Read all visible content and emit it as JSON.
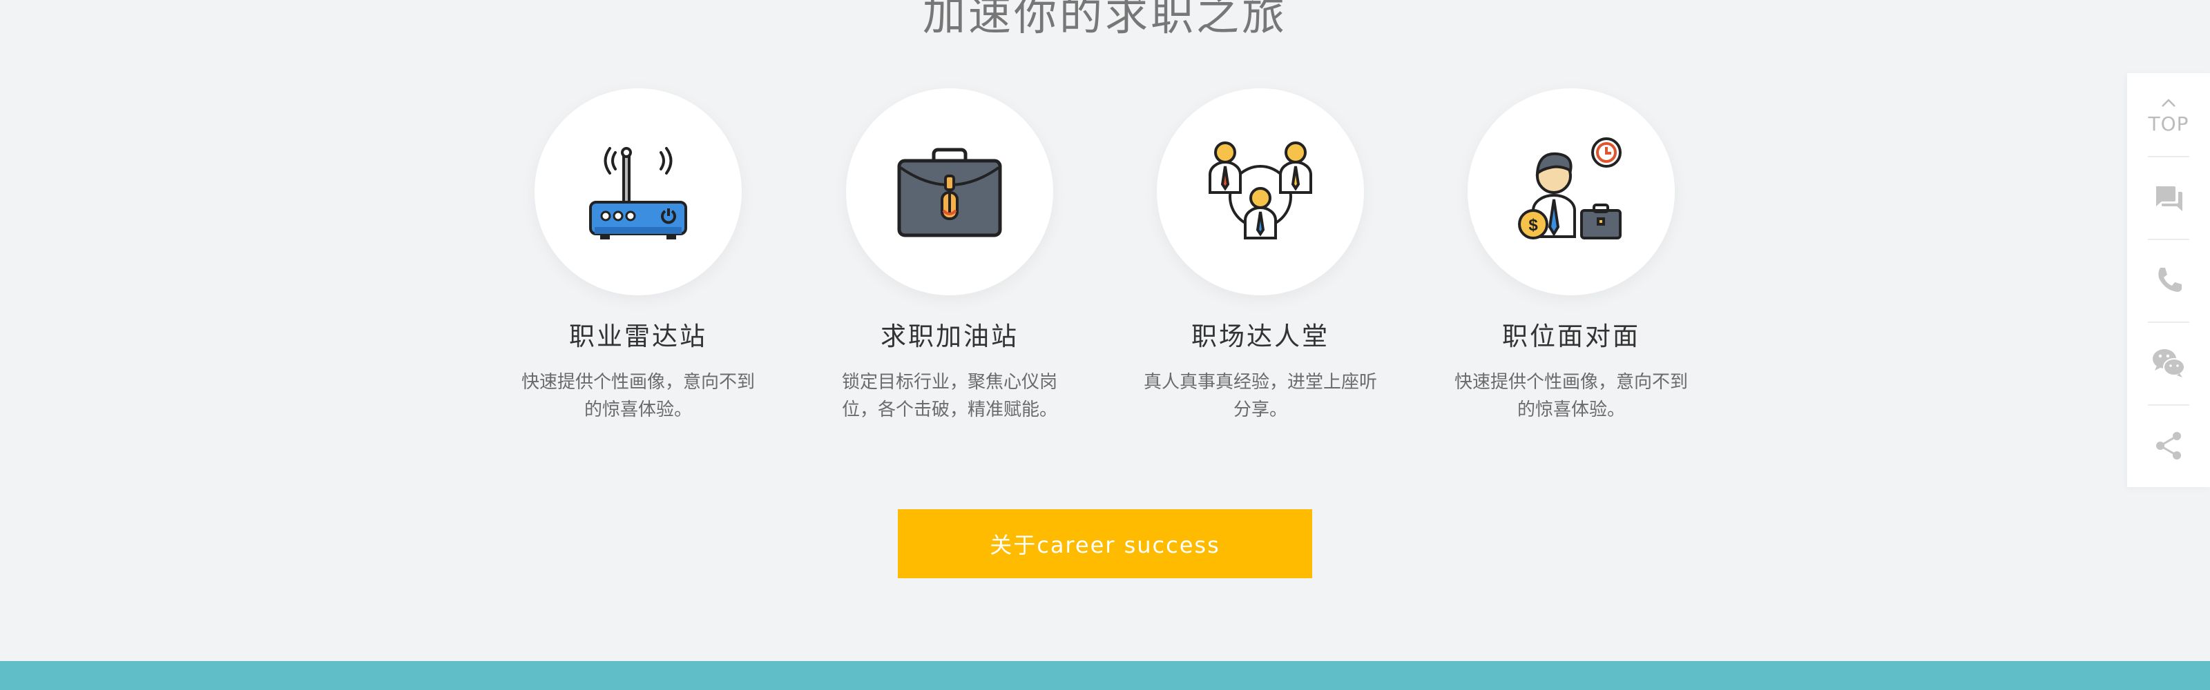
{
  "section": {
    "title": "加速你的求职之旅"
  },
  "features": [
    {
      "icon": "router-icon",
      "title": "职业雷达站",
      "desc": "快速提供个性画像，意向不到的惊喜体验。"
    },
    {
      "icon": "briefcase-icon",
      "title": "求职加油站",
      "desc": "锁定目标行业，聚焦心仪岗位，各个击破，精准赋能。"
    },
    {
      "icon": "people-network-icon",
      "title": "职场达人堂",
      "desc": "真人真事真经验，进堂上座听分享。"
    },
    {
      "icon": "job-seeker-icon",
      "title": "职位面对面",
      "desc": "快速提供个性画像，意向不到的惊喜体验。"
    }
  ],
  "cta": {
    "label": "关于career success"
  },
  "sidebar": {
    "top_label": "TOP",
    "items": [
      "chat-icon",
      "phone-icon",
      "wechat-icon",
      "share-icon"
    ]
  },
  "colors": {
    "accent": "#ffbb00",
    "footer": "#5fbec8",
    "background": "#f2f3f5"
  }
}
